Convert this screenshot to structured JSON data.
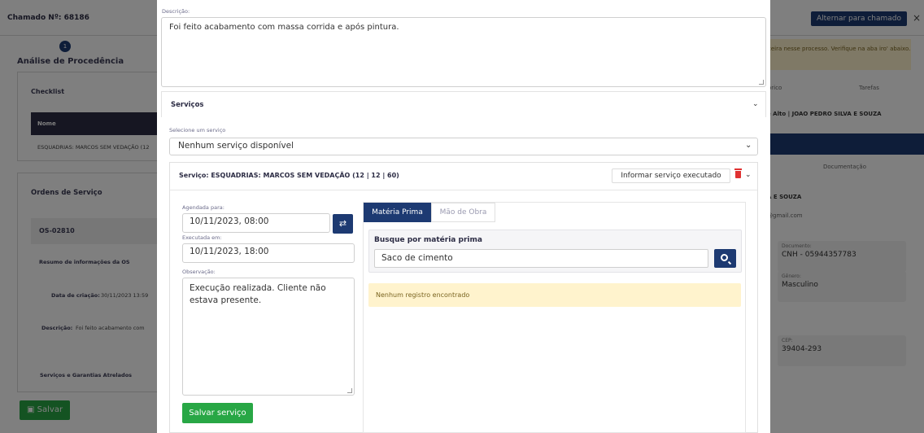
{
  "background": {
    "title": "Chamado Nº: 68186",
    "alt_button": "Alternar para chamado",
    "close": "×",
    "step_number": "1",
    "section_title": "Análise de Procedência",
    "checklist_title": "Checklist",
    "table_header": "Nome",
    "table_row": "ESQUADRIAS: MARCOS SEM VEDAÇÃO (12",
    "orders_title": "Ordens de Serviço",
    "os_number": "OS-02810",
    "os_summary": "Resumo de informações da OS",
    "created_label": "Data de criação:",
    "created_value": "30/11/2023 13:59",
    "desc_label": "Descrição:",
    "desc_value": "Foi feito acabamento com",
    "linked_services": "Serviços e Garantias Atrelados",
    "save_button": "Salvar",
    "right_note": "ceira nesse processo. Verifique na aba iro' abaixo.",
    "right_tab1": "órico",
    "right_tab2": "Tarefas",
    "right_owner": "e Alto | JOAO PEDRO SILVA E SOUZA",
    "right_tab3": "Documentação",
    "right_person": "A E SOUZA",
    "right_email": "@gmail.com",
    "doc_label": "Documento:",
    "doc_value": "CNH - 05944357783",
    "gender_label": "Gênero:",
    "gender_value": "Masculino",
    "cep_label": "CEP:",
    "cep_value": "39404-293"
  },
  "modal": {
    "description_label": "Descrição:",
    "description_value": "Foi feito acabamento com massa corrida e após pintura.",
    "services_title": "Serviços",
    "select_label": "Selecione um serviço",
    "select_value": "Nenhum serviço disponível",
    "service": {
      "title": "Serviço: ESQUADRIAS: MARCOS SEM VEDAÇÃO (12 | 12 | 60)",
      "inform_button": "Informar serviço executado",
      "scheduled_label": "Agendada para:",
      "scheduled_value": "10/11/2023, 08:00",
      "executed_label": "Executada em:",
      "executed_value": "10/11/2023, 18:00",
      "observation_label": "Observação:",
      "observation_value": "Execução realizada. Cliente não estava presente.",
      "save_button": "Salvar serviço",
      "tab_material": "Matéria Prima",
      "tab_labor": "Mão de Obra",
      "search_title": "Busque por matéria prima",
      "search_value": "Saco de cimento",
      "empty_message": "Nenhum registro encontrado"
    }
  },
  "colors": {
    "primary": "#1d3a72",
    "success": "#28a745",
    "danger": "#e03131",
    "warning_bg": "#fff3cd"
  }
}
